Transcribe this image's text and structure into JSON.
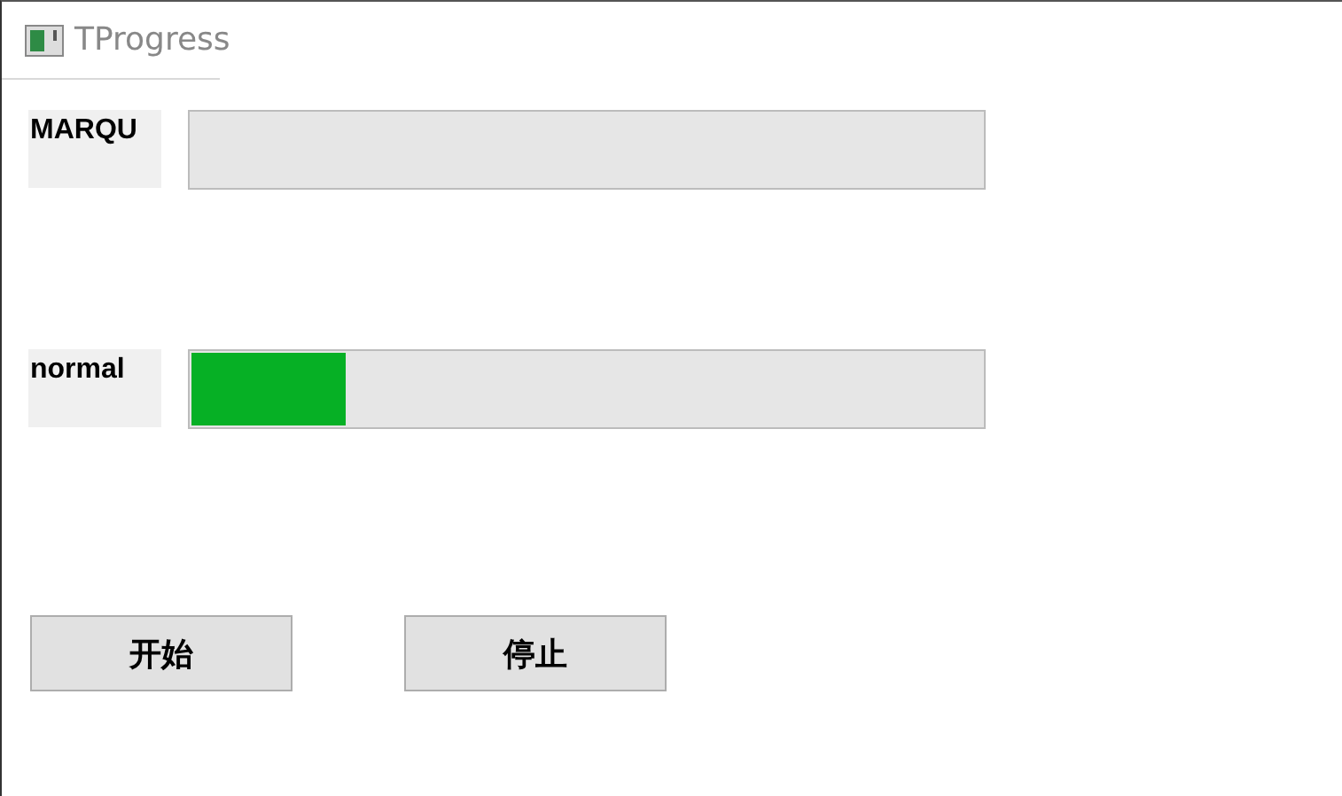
{
  "window": {
    "title": "TProgress"
  },
  "progress_rows": [
    {
      "label": "MARQU"
    },
    {
      "label": "normal",
      "level": 0.195
    }
  ],
  "buttons": [
    "开始",
    "停止"
  ]
}
